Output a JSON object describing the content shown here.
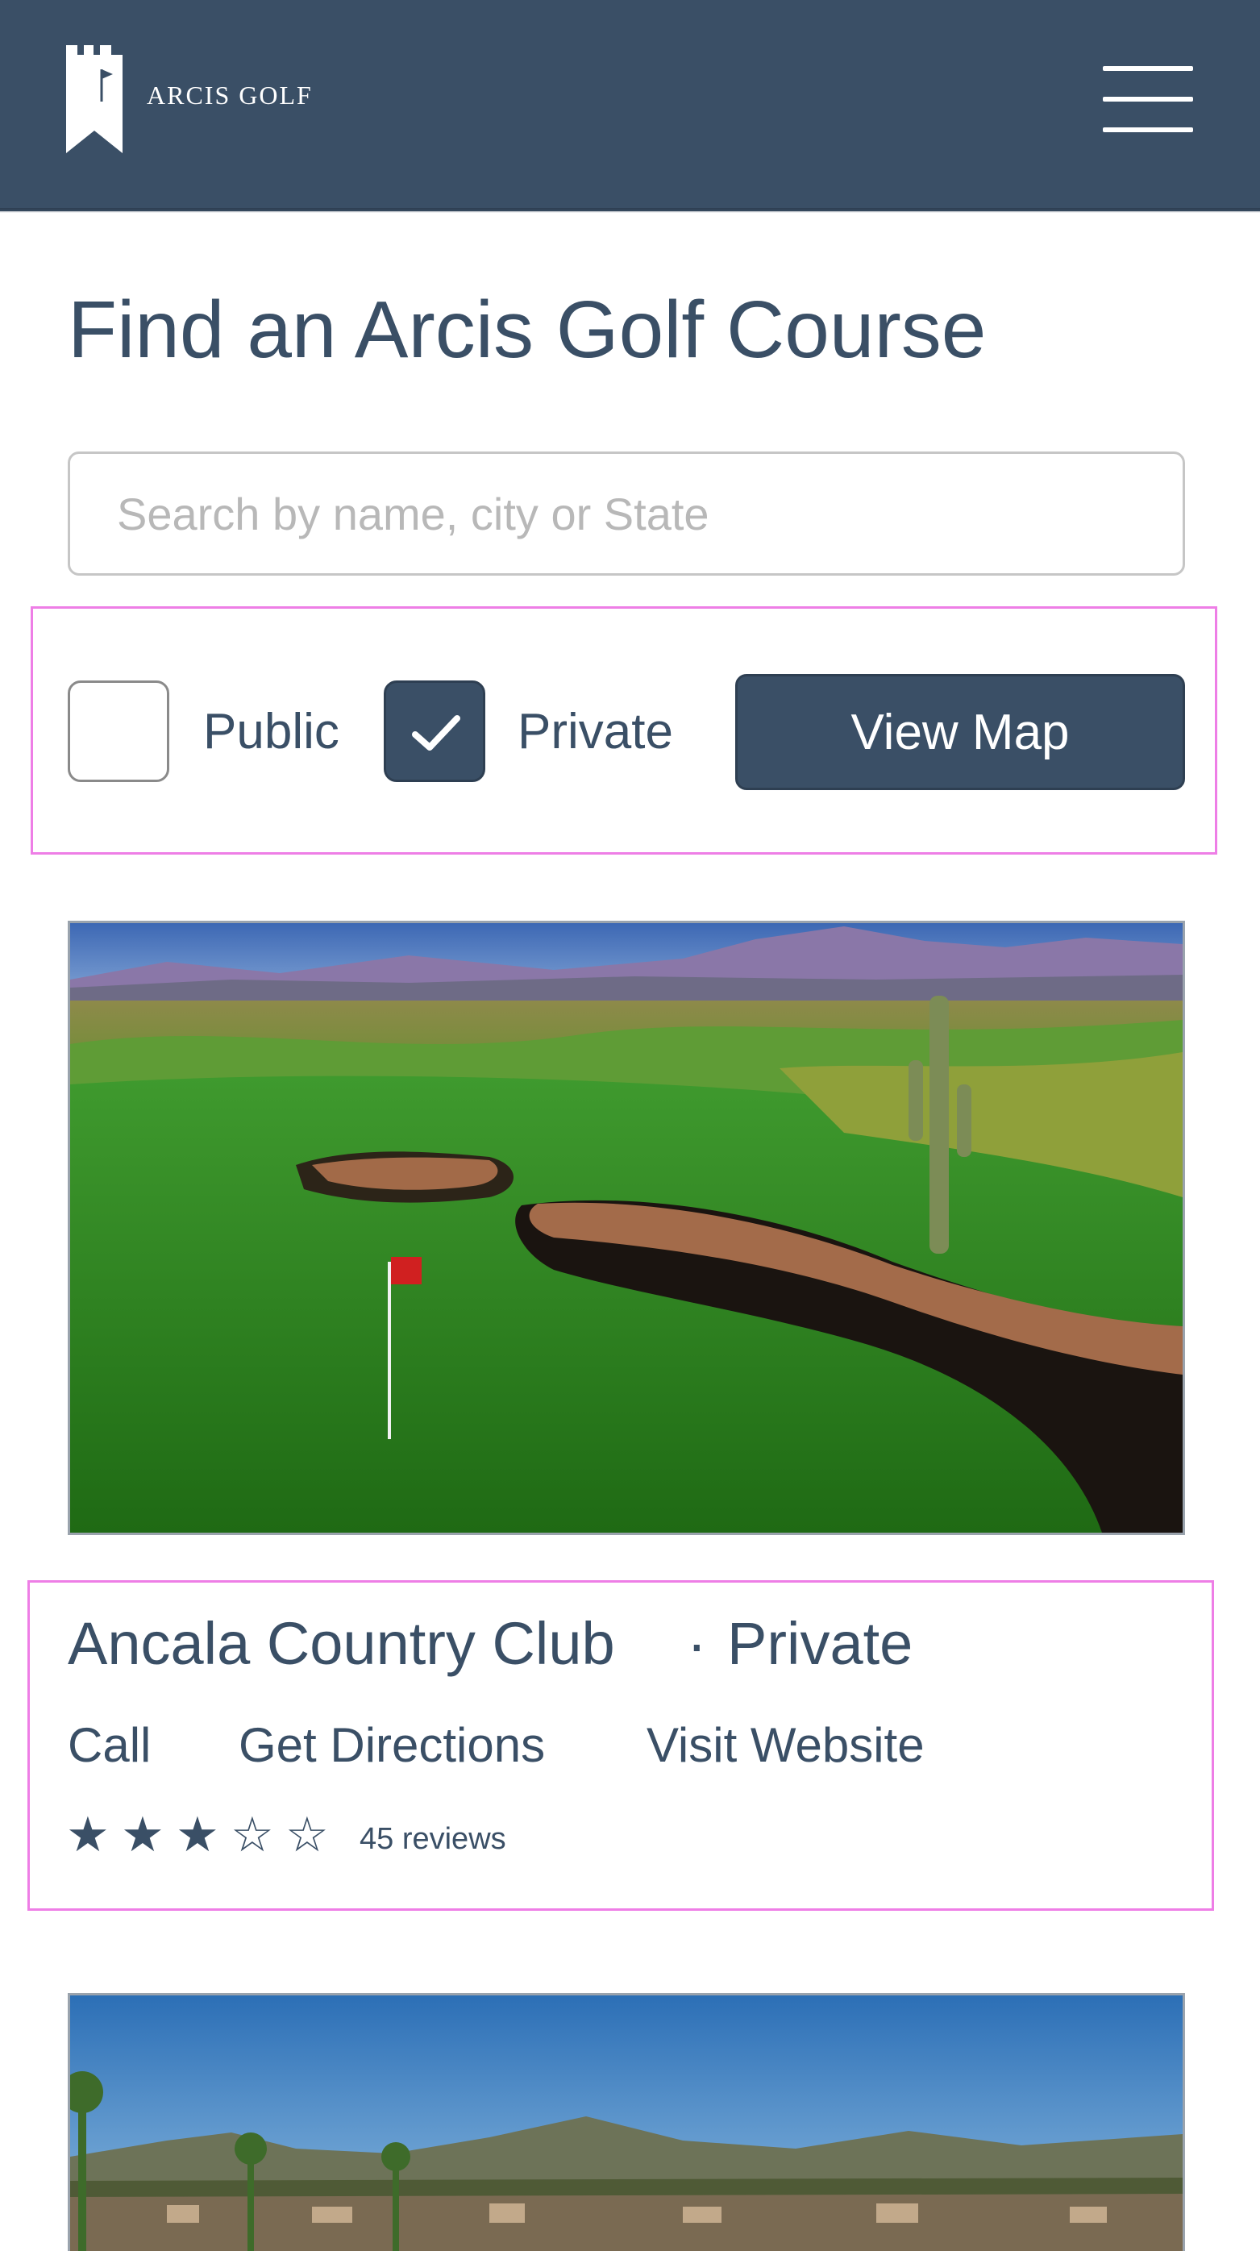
{
  "header": {
    "brand": "ARCIS GOLF",
    "color": "#3a4f66"
  },
  "page": {
    "title": "Find an Arcis Golf Course"
  },
  "search": {
    "placeholder": "Search by name, city or State",
    "value": ""
  },
  "filters": {
    "public_label": "Public",
    "public_checked": false,
    "private_label": "Private",
    "private_checked": true,
    "view_map_label": "View Map"
  },
  "courses": [
    {
      "name": "Ancala Country Club",
      "separator": "·",
      "type": "Private",
      "actions": {
        "call": "Call",
        "directions": "Get Directions",
        "website": "Visit Website"
      },
      "rating": 3,
      "rating_max": 5,
      "reviews": "45 reviews"
    }
  ],
  "icons": {
    "logo": "arcis-castle-flag-logo",
    "menu": "hamburger-icon",
    "check": "checkmark-icon",
    "star_filled": "★",
    "star_empty": "☆"
  },
  "colors": {
    "primary": "#3a4f66",
    "highlight_outline": "#ee7ee6",
    "placeholder": "#b8b8b8"
  }
}
